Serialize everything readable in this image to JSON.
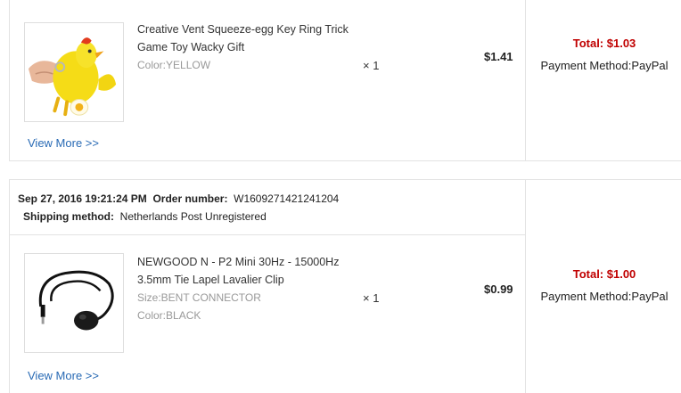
{
  "orders": [
    {
      "item": {
        "title": "Creative Vent Squeeze-egg Key Ring Trick Game Toy Wacky Gift",
        "attrs": [
          "Color:YELLOW"
        ],
        "qty": "× 1",
        "price": "$1.41",
        "image_icon": "chicken-toy-image"
      },
      "view_more": "View More >>",
      "total": "Total: $1.03",
      "payment": "Payment Method:PayPal"
    },
    {
      "date": "Sep 27, 2016 19:21:24 PM",
      "order_number_label": "Order number:",
      "order_number": "W1609271421241204",
      "shipping_label": "Shipping method:",
      "shipping_method": "Netherlands Post Unregistered",
      "item": {
        "title": "NEWGOOD N - P2 Mini 30Hz - 15000Hz 3.5mm Tie Lapel Lavalier Clip",
        "attrs": [
          "Size:BENT CONNECTOR",
          "Color:BLACK"
        ],
        "qty": "× 1",
        "price": "$0.99",
        "image_icon": "lavalier-microphone-image"
      },
      "view_more": "View More >>",
      "total": "Total: $1.00",
      "payment": "Payment Method:PayPal"
    }
  ],
  "colors": {
    "total": "#c00000",
    "link": "#2a6bb5",
    "border": "#e3e3e3",
    "attr_text": "#999999"
  }
}
